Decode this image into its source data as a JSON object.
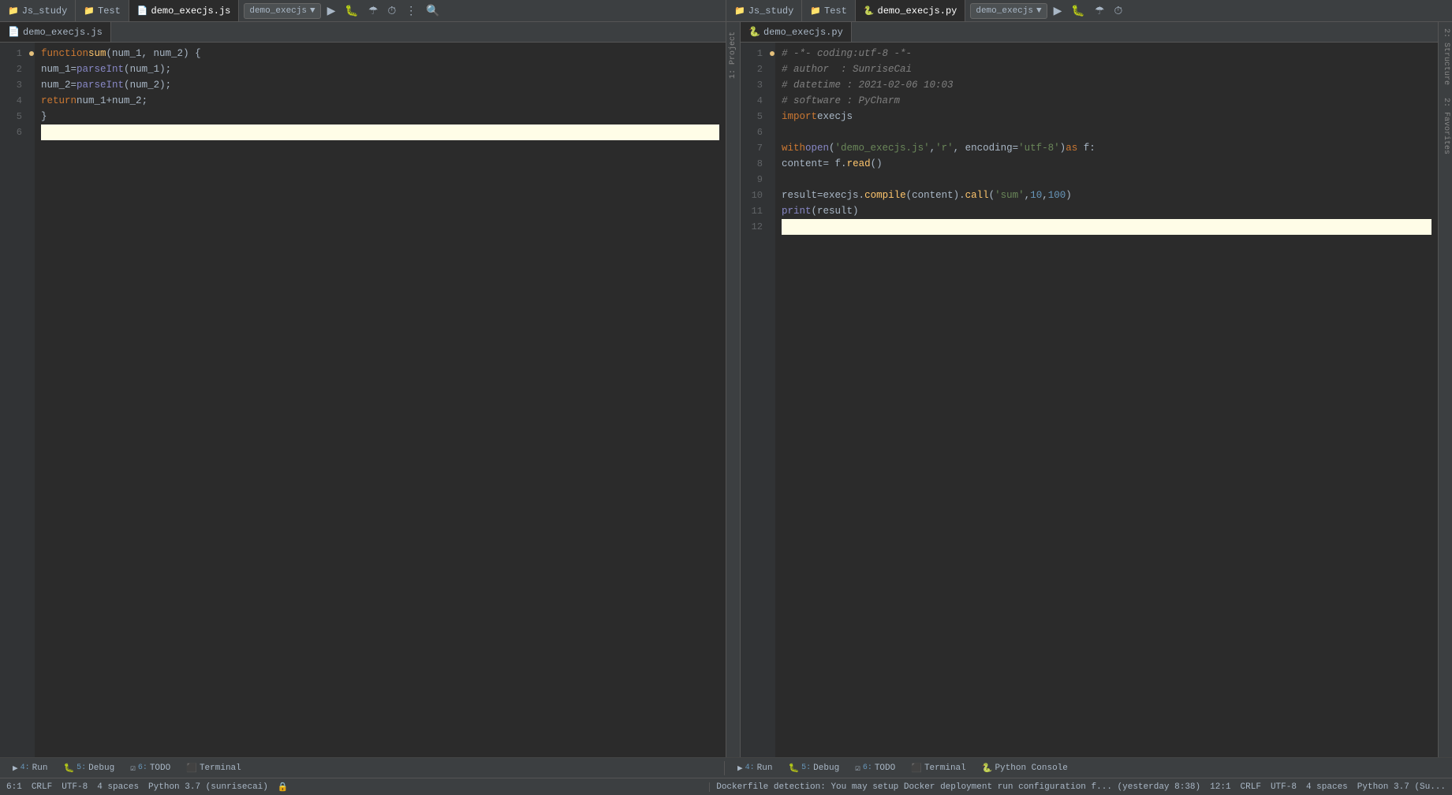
{
  "left_panel": {
    "tabs": [
      {
        "label": "Js_study",
        "icon": "📁",
        "active": false
      },
      {
        "label": "Test",
        "icon": "📁",
        "active": false
      },
      {
        "label": "demo_execjs.js",
        "icon": "📄",
        "active": true
      }
    ],
    "run_config": "demo_execjs",
    "file_tab": "demo_execjs.js",
    "lines": [
      {
        "num": 1,
        "content": "function sum(num_1, num_2) {"
      },
      {
        "num": 2,
        "content": "    num_1 = parseInt(num_1);"
      },
      {
        "num": 3,
        "content": "    num_2 = parseInt(num_2);"
      },
      {
        "num": 4,
        "content": "    return num_1 + num_2;"
      },
      {
        "num": 5,
        "content": "}"
      },
      {
        "num": 6,
        "content": "",
        "highlighted": true
      }
    ],
    "status": {
      "position": "6:1",
      "crlf": "CRLF",
      "encoding": "UTF-8",
      "indent": "4 spaces",
      "python": "Python 3.7 (sunrisecai)"
    }
  },
  "right_panel": {
    "tabs": [
      {
        "label": "Js_study",
        "icon": "📁",
        "active": false
      },
      {
        "label": "Test",
        "icon": "📁",
        "active": false
      },
      {
        "label": "demo_execjs.py",
        "icon": "🐍",
        "active": true
      }
    ],
    "run_config": "demo_execjs",
    "file_tab": "demo_execjs.py",
    "lines": [
      {
        "num": 1,
        "content": "# -*- coding:utf-8 -*-",
        "type": "comment"
      },
      {
        "num": 2,
        "content": "# author  : SunriseCai",
        "type": "comment"
      },
      {
        "num": 3,
        "content": "# datetime : 2021-02-06 10:03",
        "type": "comment"
      },
      {
        "num": 4,
        "content": "# software : PyCharm",
        "type": "comment"
      },
      {
        "num": 5,
        "content": "import execjs"
      },
      {
        "num": 6,
        "content": ""
      },
      {
        "num": 7,
        "content": "with open('demo_execjs.js', 'r', encoding='utf-8') as f:"
      },
      {
        "num": 8,
        "content": "    content = f.read()"
      },
      {
        "num": 9,
        "content": ""
      },
      {
        "num": 10,
        "content": "result = execjs.compile(content).call('sum', 10, 100)"
      },
      {
        "num": 11,
        "content": "print(result)"
      },
      {
        "num": 12,
        "content": "",
        "highlighted": true
      }
    ],
    "status": {
      "position": "12:1",
      "crlf": "CRLF",
      "encoding": "UTF-8",
      "indent": "4 spaces",
      "python": "Python 3.7 (Su..."
    }
  },
  "bottom_tabs": [
    {
      "num": "4:",
      "label": "Run",
      "icon": "▶"
    },
    {
      "num": "5:",
      "label": "Debug",
      "icon": "🐛"
    },
    {
      "num": "6:",
      "label": "TODO",
      "icon": "☑"
    },
    {
      "label": "Terminal",
      "icon": "⬛"
    },
    {
      "label": "Python Console",
      "icon": "🐍"
    }
  ],
  "notification": "Dockerfile detection: You may setup Docker deployment run configuration f... (yesterday 8:38)",
  "sidebar_labels": {
    "project": "1: Project",
    "structure": "2: Structure",
    "favorites": "2: Favorites"
  }
}
